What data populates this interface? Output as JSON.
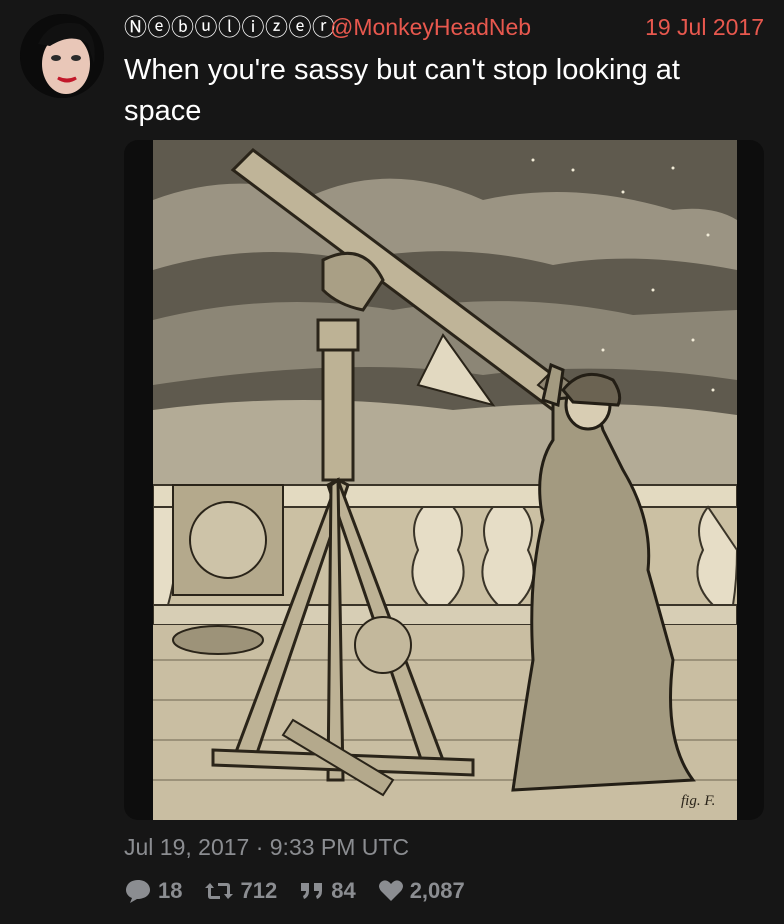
{
  "tweet": {
    "display_name": "Ⓝⓔⓑⓤⓛⓘⓩⓔⓡ",
    "handle": "@MonkeyHeadNeb",
    "date": "19 Jul 2017",
    "text": "When you're sassy but can't stop looking at space",
    "timestamp": "Jul 19, 2017 · 9:33 PM UTC",
    "media": {
      "caption_mark": "fig. F."
    }
  },
  "stats": {
    "replies": "18",
    "retweets": "712",
    "quotes": "84",
    "likes": "2,087"
  },
  "colors": {
    "background": "#161616",
    "accent": "#e8584e",
    "muted": "#8b8d91"
  },
  "icons": {
    "reply": "comment-bubble-icon",
    "retweet": "retweet-arrows-icon",
    "quote": "quote-marks-icon",
    "like": "heart-icon"
  }
}
